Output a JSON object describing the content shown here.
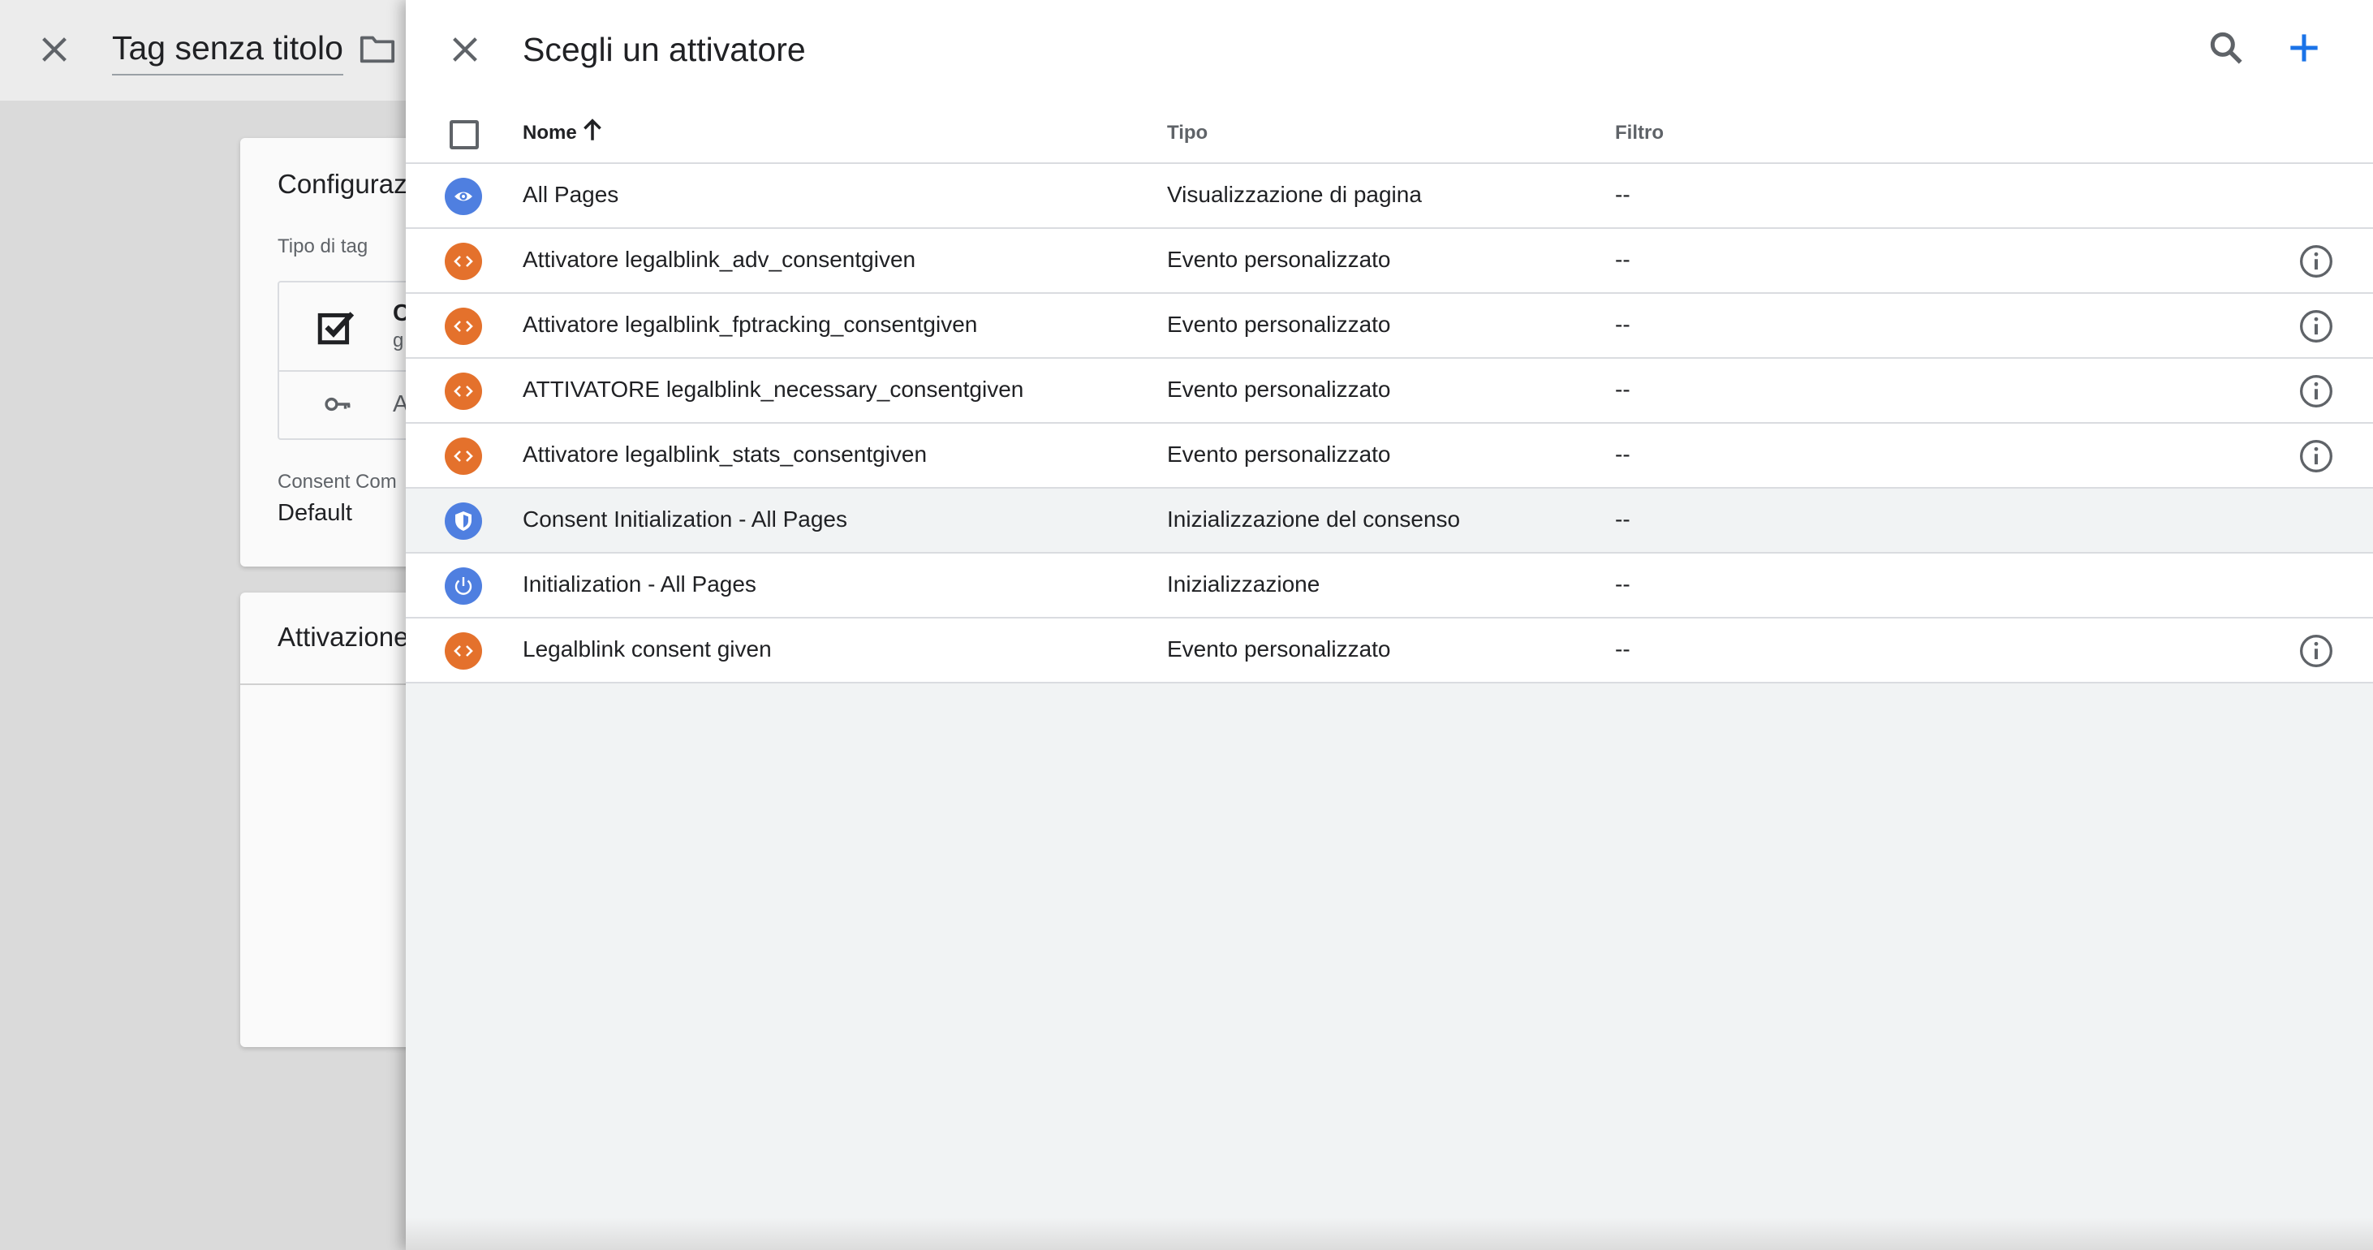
{
  "background": {
    "tag_title": "Tag senza titolo",
    "config_card": {
      "title": "Configuraz",
      "tag_type_label": "Tipo di tag",
      "tag_type_name": "C",
      "tag_type_sub": "g",
      "tag_type_row2": "A",
      "consent_label": "Consent Com",
      "consent_value": "Default"
    },
    "trigger_card": {
      "title": "Attivazione"
    }
  },
  "panel": {
    "title": "Scegli un attivatore",
    "columns": {
      "name": "Nome",
      "type": "Tipo",
      "filter": "Filtro"
    },
    "rows": [
      {
        "name": "All Pages",
        "type": "Visualizzazione di pagina",
        "filter": "--",
        "icon": "eye-icon",
        "color": "blue",
        "info": false
      },
      {
        "name": "Attivatore legalblink_adv_consentgiven",
        "type": "Evento personalizzato",
        "filter": "--",
        "icon": "code-icon",
        "color": "orange",
        "info": true
      },
      {
        "name": "Attivatore legalblink_fptracking_consentgiven",
        "type": "Evento personalizzato",
        "filter": "--",
        "icon": "code-icon",
        "color": "orange",
        "info": true
      },
      {
        "name": "ATTIVATORE legalblink_necessary_consentgiven",
        "type": "Evento personalizzato",
        "filter": "--",
        "icon": "code-icon",
        "color": "orange",
        "info": true
      },
      {
        "name": "Attivatore legalblink_stats_consentgiven",
        "type": "Evento personalizzato",
        "filter": "--",
        "icon": "code-icon",
        "color": "orange",
        "info": true
      },
      {
        "name": "Consent Initialization - All Pages",
        "type": "Inizializzazione del consenso",
        "filter": "--",
        "icon": "shield-icon",
        "color": "blue",
        "info": false,
        "highlighted": true
      },
      {
        "name": "Initialization - All Pages",
        "type": "Inizializzazione",
        "filter": "--",
        "icon": "power-icon",
        "color": "blue",
        "info": false
      },
      {
        "name": "Legalblink consent given",
        "type": "Evento personalizzato",
        "filter": "--",
        "icon": "code-icon",
        "color": "orange",
        "info": true
      }
    ]
  },
  "colors": {
    "accent_blue": "#1a73e8",
    "trigger_blue": "#4f7fe0",
    "trigger_orange": "#e4712c"
  }
}
